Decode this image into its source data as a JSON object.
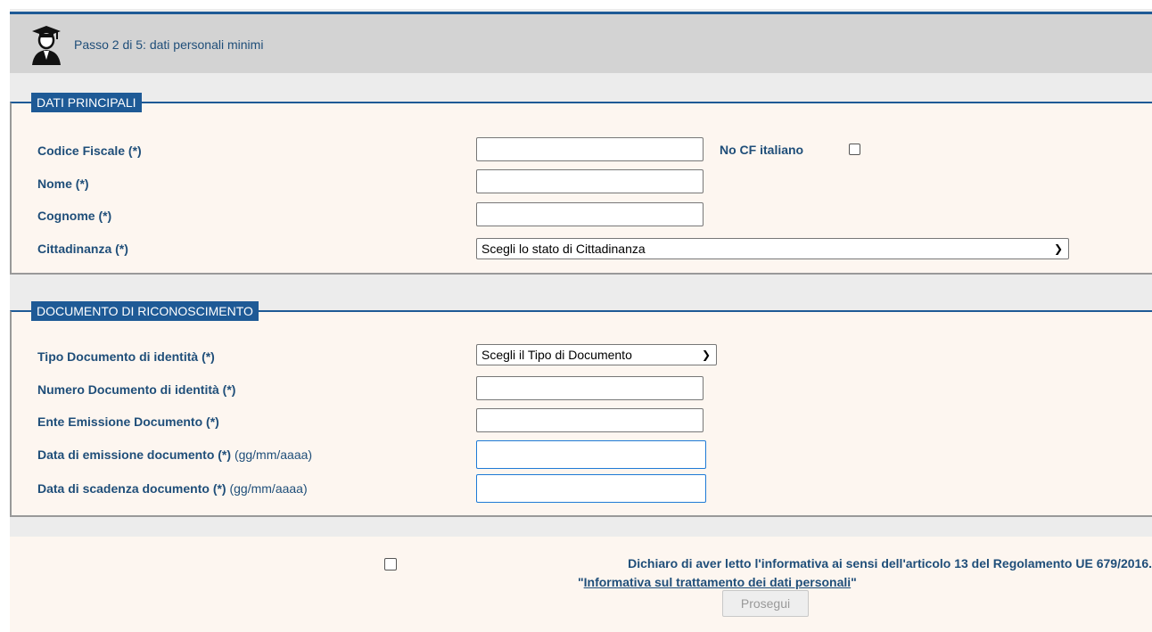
{
  "header": {
    "icon": "graduate-icon",
    "title": "Passo 2 di 5: dati personali minimi"
  },
  "dati_principali": {
    "legend": "DATI PRINCIPALI",
    "codice_fiscale_label": "Codice Fiscale (*)",
    "codice_fiscale_value": "",
    "no_cf_label": "No CF italiano",
    "nome_label": "Nome (*)",
    "nome_value": "",
    "cognome_label": "Cognome (*)",
    "cognome_value": "",
    "cittadinanza_label": "Cittadinanza (*)",
    "cittadinanza_selected": "Scegli lo stato di Cittadinanza"
  },
  "documento": {
    "legend": "DOCUMENTO DI RICONOSCIMENTO",
    "tipo_label": "Tipo Documento di identità (*)",
    "tipo_selected": "Scegli il Tipo di Documento",
    "numero_label": "Numero Documento di identità (*)",
    "numero_value": "",
    "ente_label": "Ente Emissione Documento (*)",
    "ente_value": "",
    "emissione_label": "Data di emissione documento (*)",
    "emissione_hint": "(gg/mm/aaaa)",
    "emissione_value": "",
    "scadenza_label": "Data di scadenza documento (*)",
    "scadenza_hint": "(gg/mm/aaaa)",
    "scadenza_value": ""
  },
  "consent": {
    "text": "Dichiaro di aver letto l'informativa ai sensi dell'articolo 13 del Regolamento UE 679/2016.",
    "quote_open": "\"",
    "link_text": "Informativa sul trattamento dei dati personali",
    "quote_close": "\"",
    "submit_label": "Prosegui"
  },
  "colors": {
    "accent": "#1e5a96",
    "text": "#1f4e79",
    "panel_bg": "#fdf6f0",
    "header_bg": "#d3d3d3"
  }
}
